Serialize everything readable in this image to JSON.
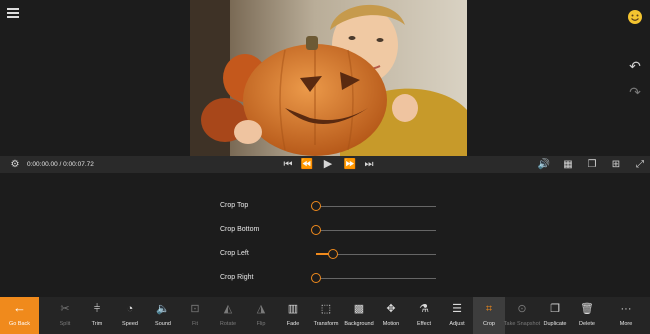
{
  "preview": {
    "timecode": "0:00:00.00 / 0:00:07.72",
    "icons": [
      "menu-icon",
      "emoji-icon",
      "undo-icon",
      "redo-icon"
    ]
  },
  "transport": {
    "icons": [
      "settings-icon",
      "skip-start-icon",
      "step-back-icon",
      "play-icon",
      "step-forward-icon",
      "skip-end-icon",
      "volume-icon",
      "grid-icon",
      "copy-icon",
      "layout-icon",
      "expand-icon"
    ]
  },
  "crop": {
    "rows": [
      {
        "label": "Crop Top",
        "value": 0
      },
      {
        "label": "Crop Bottom",
        "value": 0
      },
      {
        "label": "Crop Left",
        "value": 0.14
      },
      {
        "label": "Crop Right",
        "value": 0
      }
    ]
  },
  "toolbar": {
    "go_back": "Go Back",
    "tools": [
      {
        "label": "Split",
        "icon": "scissors-icon",
        "enabled": false
      },
      {
        "label": "Trim",
        "icon": "trim-icon",
        "enabled": true
      },
      {
        "label": "Speed",
        "icon": "speedometer-icon",
        "enabled": true
      },
      {
        "label": "Sound",
        "icon": "sound-icon",
        "enabled": true
      },
      {
        "label": "Fit",
        "icon": "fit-icon",
        "enabled": false
      },
      {
        "label": "Rotate",
        "icon": "rotate-icon",
        "enabled": false
      },
      {
        "label": "Flip",
        "icon": "flip-icon",
        "enabled": false
      },
      {
        "label": "Fade",
        "icon": "fade-icon",
        "enabled": true
      },
      {
        "label": "Transform",
        "icon": "transform-icon",
        "enabled": true
      },
      {
        "label": "Background",
        "icon": "background-icon",
        "enabled": true
      },
      {
        "label": "Motion",
        "icon": "motion-icon",
        "enabled": true
      },
      {
        "label": "Effect",
        "icon": "effect-icon",
        "enabled": true
      },
      {
        "label": "Adjust",
        "icon": "adjust-icon",
        "enabled": true
      },
      {
        "label": "Crop",
        "icon": "crop-icon",
        "enabled": true,
        "active": true
      },
      {
        "label": "Take Snapshot",
        "icon": "snapshot-icon",
        "enabled": false
      },
      {
        "label": "Duplicate",
        "icon": "duplicate-icon",
        "enabled": true
      },
      {
        "label": "Delete",
        "icon": "delete-icon",
        "enabled": true
      },
      {
        "label": "More",
        "icon": "more-icon",
        "enabled": true
      }
    ]
  },
  "colors": {
    "accent": "#f08a1c",
    "background": "#1f1f1f"
  }
}
